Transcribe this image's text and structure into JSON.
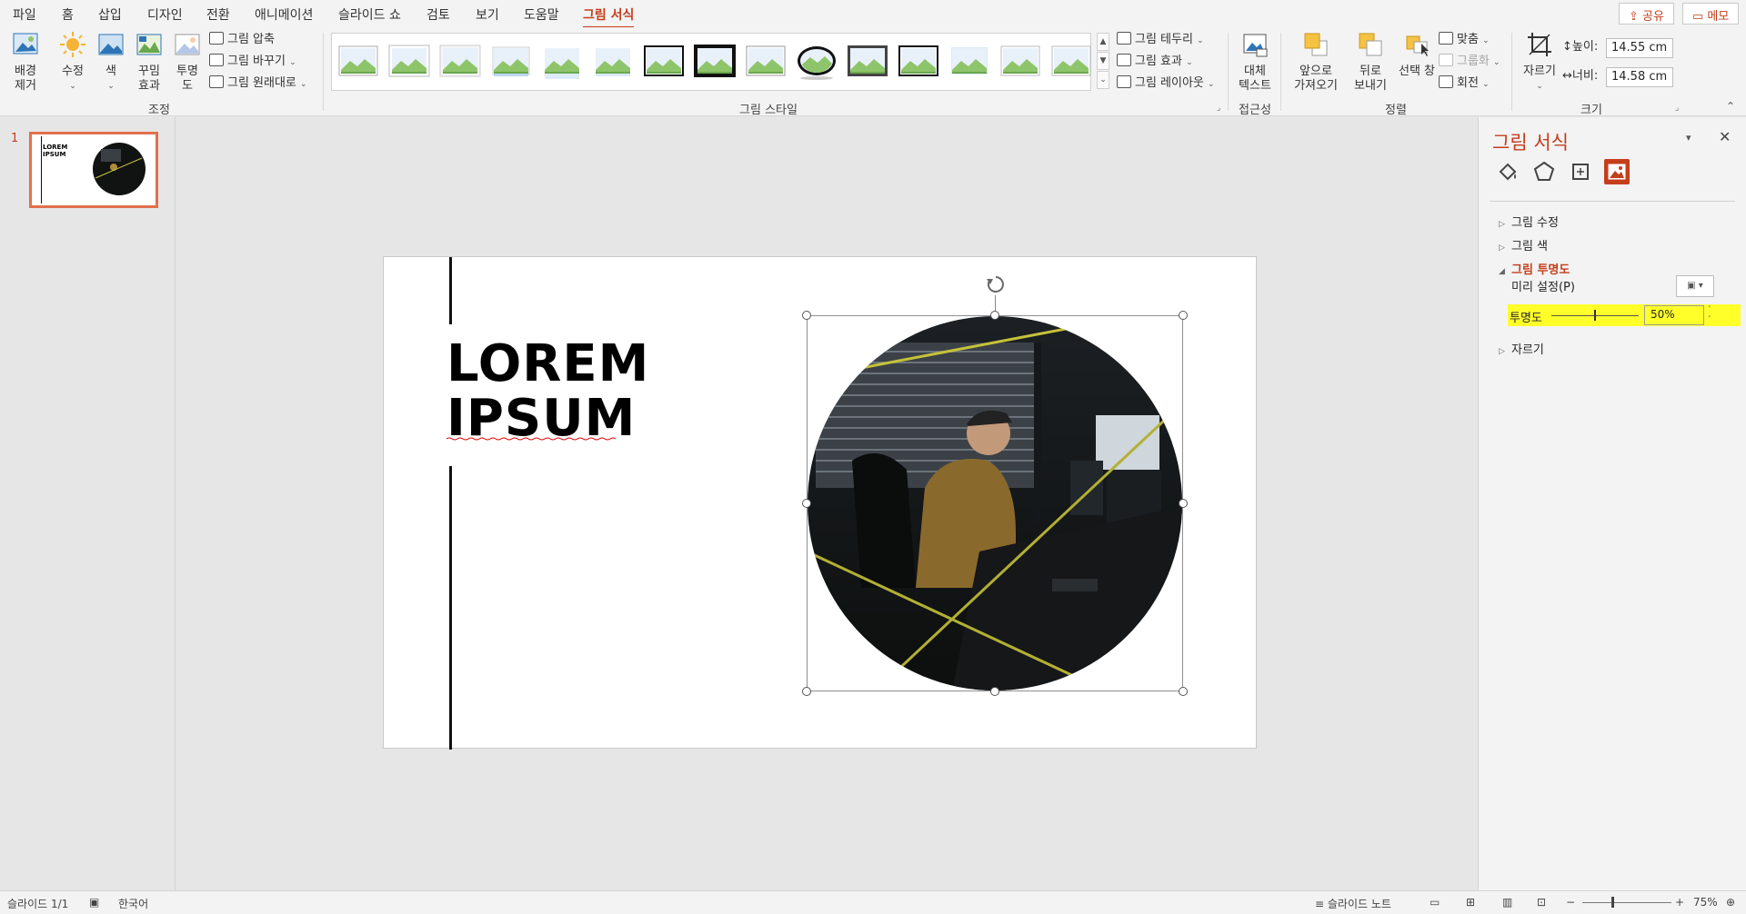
{
  "menu": {
    "tabs": [
      "파일",
      "홈",
      "삽입",
      "디자인",
      "전환",
      "애니메이션",
      "슬라이드 쇼",
      "검토",
      "보기",
      "도움말",
      "그림 서식"
    ],
    "active_tab": "그림 서식",
    "share_label": "공유",
    "memo_label": "메모"
  },
  "ribbon": {
    "adjust": {
      "remove_bg": "배경\n제거",
      "corrections": "수정",
      "color": "색",
      "artistic": "꾸밈\n효과",
      "transparency": "투명\n도",
      "compress": "그림 압축",
      "change": "그림 바꾸기",
      "reset": "그림 원래대로",
      "label": "조정"
    },
    "styles": {
      "label": "그림 스타일",
      "border": "그림 테두리",
      "effects": "그림 효과",
      "layout": "그림 레이아웃"
    },
    "access": {
      "alt_text": "대체\n텍스트",
      "label": "접근성"
    },
    "arrange": {
      "forward": "앞으로\n가져오기",
      "backward": "뒤로\n보내기",
      "selection": "선택 창",
      "align": "맞춤",
      "group": "그룹화",
      "rotate": "회전",
      "label": "정렬"
    },
    "size": {
      "crop": "자르기",
      "height_label": "높이:",
      "height_value": "14.55 cm",
      "width_label": "너비:",
      "width_value": "14.58 cm",
      "label": "크기"
    }
  },
  "thumbnails": {
    "slide_number": "1"
  },
  "slide": {
    "title": "LOREM\nIPSUM",
    "thumb_title": "LOREM\nIPSUM"
  },
  "panel": {
    "title": "그림 서식",
    "sections": {
      "corrections": "그림 수정",
      "color": "그림 색",
      "transparency": "그림 투명도",
      "preset": "미리 설정(P)",
      "transparency_label": "투명도",
      "transparency_value": "50%",
      "crop": "자르기"
    },
    "transparency_fraction": 0.5
  },
  "status": {
    "slide": "슬라이드 1/1",
    "language": "한국어",
    "notes": "슬라이드 노트",
    "zoom": "75%"
  },
  "colors": {
    "accent": "#c43e1c",
    "highlight": "#ffff2a",
    "thumb_border": "#e2704d"
  }
}
